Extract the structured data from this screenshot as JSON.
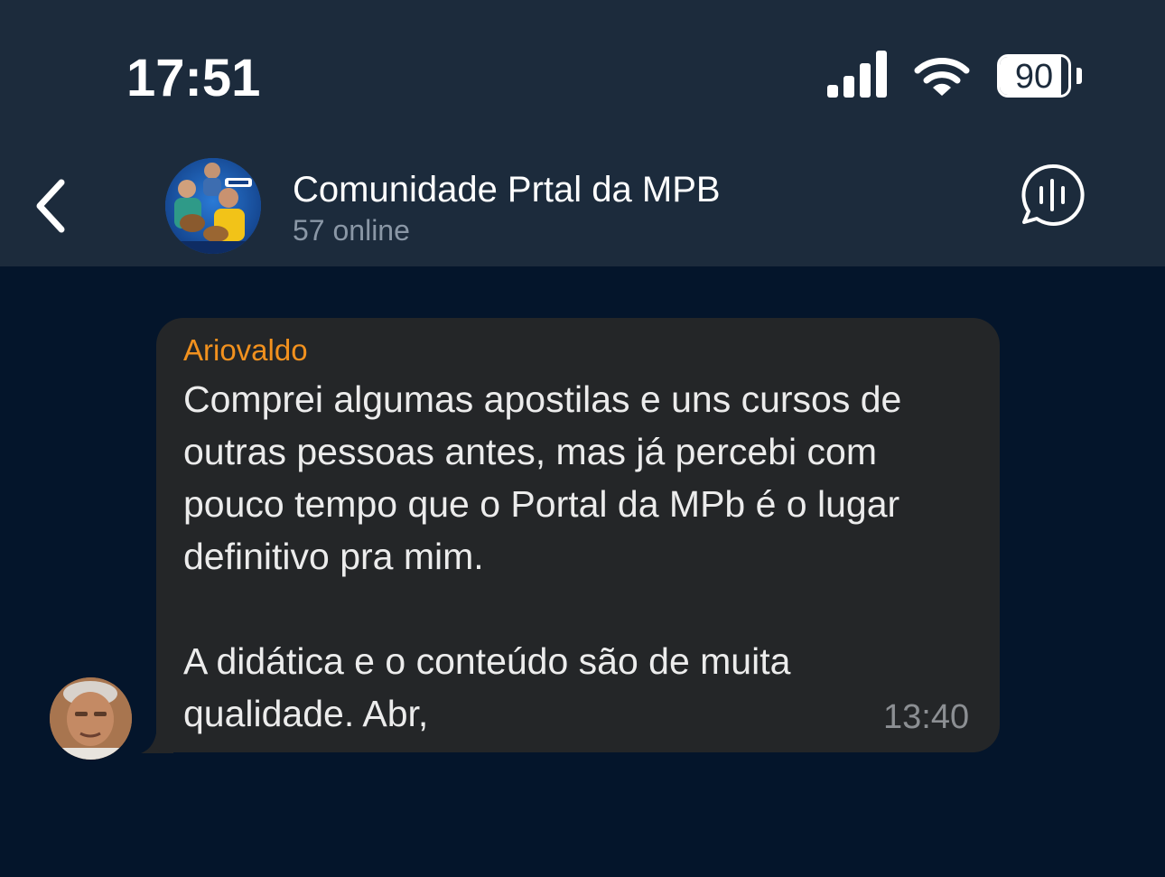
{
  "status_bar": {
    "time": "17:51",
    "battery_level": "90",
    "battery_percent": 90,
    "signal_icon": "signal-bars-icon",
    "wifi_icon": "wifi-icon"
  },
  "header": {
    "back_icon": "chevron-left-icon",
    "title": "Comunidade Prtal da MPB",
    "subtitle": "57 online",
    "voice_chat_icon": "voice-chat-icon"
  },
  "messages": [
    {
      "sender": "Ariovaldo",
      "sender_color": "#f2911e",
      "lines": [
        "Comprei algumas apostilas e uns cursos de",
        "outras pessoas antes, mas já percebi com",
        "pouco tempo que o Portal da MPb é o lugar",
        "definitivo pra mim.",
        "",
        "A didática e o conteúdo são de muita",
        "qualidade. Abr,"
      ],
      "time": "13:40"
    }
  ],
  "colors": {
    "header_bg": "#1c2b3c",
    "chat_bg": "#04152b",
    "bubble_bg": "#242628",
    "accent": "#f2911e"
  }
}
